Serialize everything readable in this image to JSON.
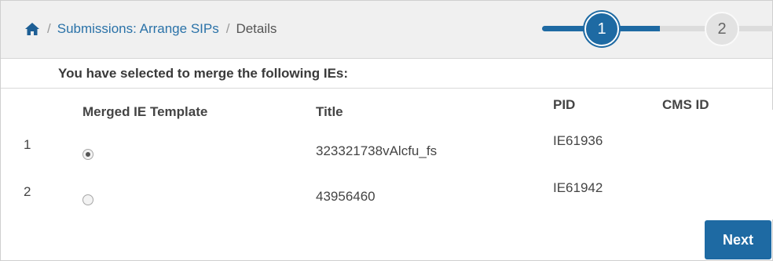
{
  "breadcrumb": {
    "home_icon": "home-icon",
    "separator": "/",
    "link": "Submissions: Arrange SIPs",
    "current": "Details"
  },
  "stepper": {
    "steps": [
      "1",
      "2"
    ],
    "active_step": 1,
    "active_color": "#1e6aa3"
  },
  "intro_text": "You have selected to merge the following IEs:",
  "table": {
    "columns": {
      "template": "Merged IE Template",
      "title": "Title",
      "pid": "PID",
      "cms_id": "CMS ID"
    },
    "rows": [
      {
        "index": "1",
        "selected": true,
        "title": "323321738vAlcfu_fs",
        "pid": "IE61936",
        "cms_id": ""
      },
      {
        "index": "2",
        "selected": false,
        "title": "43956460",
        "pid": "IE61942",
        "cms_id": ""
      }
    ]
  },
  "actions": {
    "next_label": "Next"
  }
}
